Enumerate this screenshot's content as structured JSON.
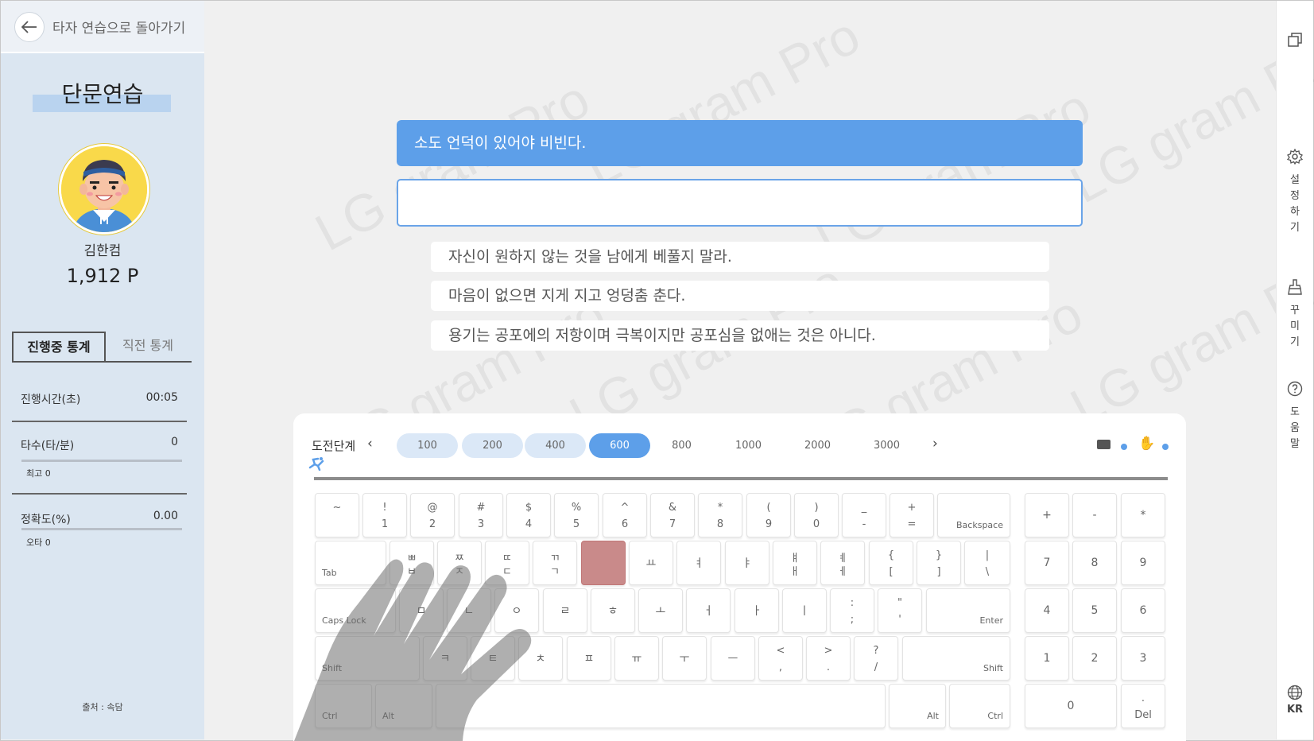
{
  "sidebar": {
    "back_label": "타자 연습으로 돌아가기",
    "title": "단문연습",
    "user_name": "김한컴",
    "points": "1,912 P",
    "tabs": [
      "진행중 통계",
      "직전 통계"
    ],
    "stats": {
      "time_label": "진행시간(초)",
      "time_value": "00:05",
      "speed_label": "타수(타/분)",
      "speed_value": "0",
      "speed_best": "최고 0",
      "accuracy_label": "정확도(%)",
      "accuracy_value": "0.00",
      "typo_count": "오타 0"
    },
    "source": "출처 : 속담"
  },
  "main": {
    "watermark": "LG gram Pro",
    "target_sentence": "소도 언덕이 있어야 비빈다.",
    "input_value": "",
    "next_sentences": [
      "자신이 원하지 않는 것을 남에게 베풀지 말라.",
      "마음이 없으면 지게 지고 엉덩춤 춘다.",
      "용기는 공포에의 저항이며 극복이지만 공포심을 없애는 것은 아니다."
    ]
  },
  "keyboard_panel": {
    "level_label": "도전단계",
    "levels": [
      "100",
      "200",
      "400",
      "600",
      "800",
      "1000",
      "2000",
      "3000"
    ],
    "active_level": "600",
    "prev_arrow": "‹",
    "next_arrow": "›"
  },
  "keyboard": {
    "number_row": [
      {
        "t": "~",
        "b": ""
      },
      {
        "t": "!",
        "b": "1"
      },
      {
        "t": "@",
        "b": "2"
      },
      {
        "t": "#",
        "b": "3"
      },
      {
        "t": "$",
        "b": "4"
      },
      {
        "t": "%",
        "b": "5"
      },
      {
        "t": "^",
        "b": "6"
      },
      {
        "t": "&",
        "b": "7"
      },
      {
        "t": "*",
        "b": "8"
      },
      {
        "t": "(",
        "b": "9"
      },
      {
        "t": ")",
        "b": "0"
      },
      {
        "t": "_",
        "b": "-"
      },
      {
        "t": "+",
        "b": "="
      }
    ],
    "backspace": "Backspace",
    "tab": "Tab",
    "top_row": [
      {
        "t": "ㅃ",
        "b": "ㅂ"
      },
      {
        "t": "ㅉ",
        "b": "ㅈ"
      },
      {
        "t": "ㄸ",
        "b": "ㄷ"
      },
      {
        "t": "ㄲ",
        "b": "ㄱ"
      },
      {
        "t": "",
        "b": ""
      },
      {
        "t": "",
        "b": "ㅛ"
      },
      {
        "t": "",
        "b": "ㅕ"
      },
      {
        "t": "",
        "b": "ㅑ"
      },
      {
        "t": "ㅒ",
        "b": "ㅐ"
      },
      {
        "t": "ㅖ",
        "b": "ㅔ"
      },
      {
        "t": "{",
        "b": "["
      },
      {
        "t": "}",
        "b": "]"
      },
      {
        "t": "|",
        "b": "\\"
      }
    ],
    "caps_lock": "Caps Lock",
    "home_row": [
      {
        "t": "",
        "b": "ㅁ"
      },
      {
        "t": "",
        "b": "ㄴ"
      },
      {
        "t": "",
        "b": "ㅇ"
      },
      {
        "t": "",
        "b": "ㄹ"
      },
      {
        "t": "",
        "b": "ㅎ"
      },
      {
        "t": "",
        "b": "ㅗ"
      },
      {
        "t": "",
        "b": "ㅓ"
      },
      {
        "t": "",
        "b": "ㅏ"
      },
      {
        "t": "",
        "b": "ㅣ"
      },
      {
        "t": ":",
        "b": ";"
      },
      {
        "t": "\"",
        "b": "'"
      }
    ],
    "enter": "Enter",
    "shift": "Shift",
    "bottom_row": [
      {
        "t": "",
        "b": "ㅋ"
      },
      {
        "t": "",
        "b": "ㅌ"
      },
      {
        "t": "",
        "b": "ㅊ"
      },
      {
        "t": "",
        "b": "ㅍ"
      },
      {
        "t": "",
        "b": "ㅠ"
      },
      {
        "t": "",
        "b": "ㅜ"
      },
      {
        "t": "",
        "b": "ㅡ"
      },
      {
        "t": "<",
        "b": ","
      },
      {
        "t": ">",
        "b": "."
      },
      {
        "t": "?",
        "b": "/"
      }
    ],
    "ctrl": "Ctrl",
    "alt": "Alt",
    "numpad": [
      "+",
      "-",
      "*",
      "7",
      "8",
      "9",
      "4",
      "5",
      "6",
      "1",
      "2",
      "3",
      "0"
    ],
    "numpad_del_top": ".",
    "numpad_del": "Del",
    "highlight_color": "#c98a8a"
  },
  "rail": {
    "settings_label": "설정하기",
    "decorate_label": "꾸미기",
    "help_label": "도움말",
    "lang_label": "KR"
  },
  "colors": {
    "accent": "#5d9fe9",
    "sidebar": "#dbe6f1"
  }
}
